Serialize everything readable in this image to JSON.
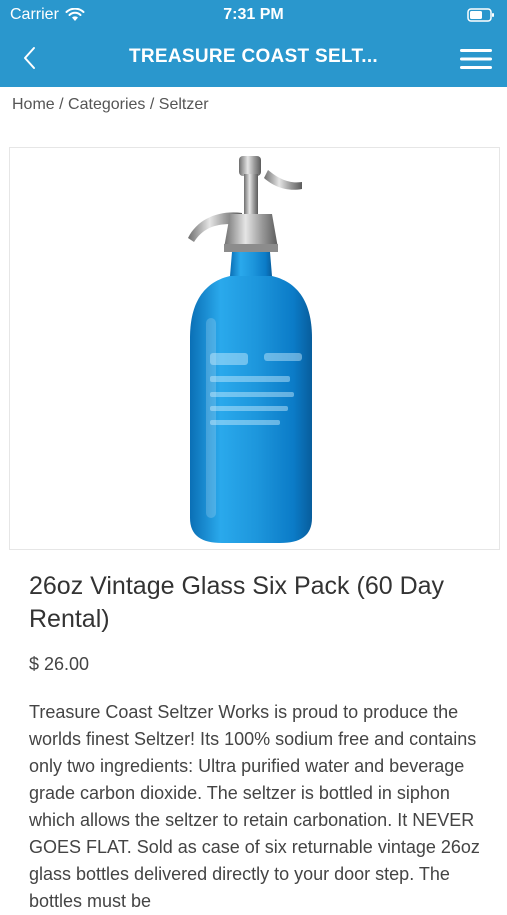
{
  "status_bar": {
    "carrier": "Carrier",
    "time": "7:31 PM"
  },
  "nav": {
    "title": "TREASURE COAST SELT..."
  },
  "breadcrumb": {
    "items": [
      "Home",
      "Categories",
      "Seltzer"
    ],
    "separator": "/"
  },
  "product": {
    "title": "26oz Vintage Glass Six Pack (60 Day Rental)",
    "price": "$ 26.00",
    "description": "Treasure Coast Seltzer Works is proud to produce the worlds finest Seltzer! Its 100% sodium free and contains only two ingredients: Ultra purified water and beverage grade carbon dioxide. The seltzer is bottled in siphon which allows the seltzer to retain carbonation. It NEVER GOES FLAT. Sold as case of six returnable vintage 26oz glass bottles delivered directly to your door step. The bottles must be"
  },
  "colors": {
    "header": "#2a97cd",
    "bottle": "#1a9be0"
  },
  "icons": {
    "back": "chevron-left-icon",
    "menu": "hamburger-icon",
    "wifi": "wifi-icon",
    "battery": "battery-icon"
  }
}
